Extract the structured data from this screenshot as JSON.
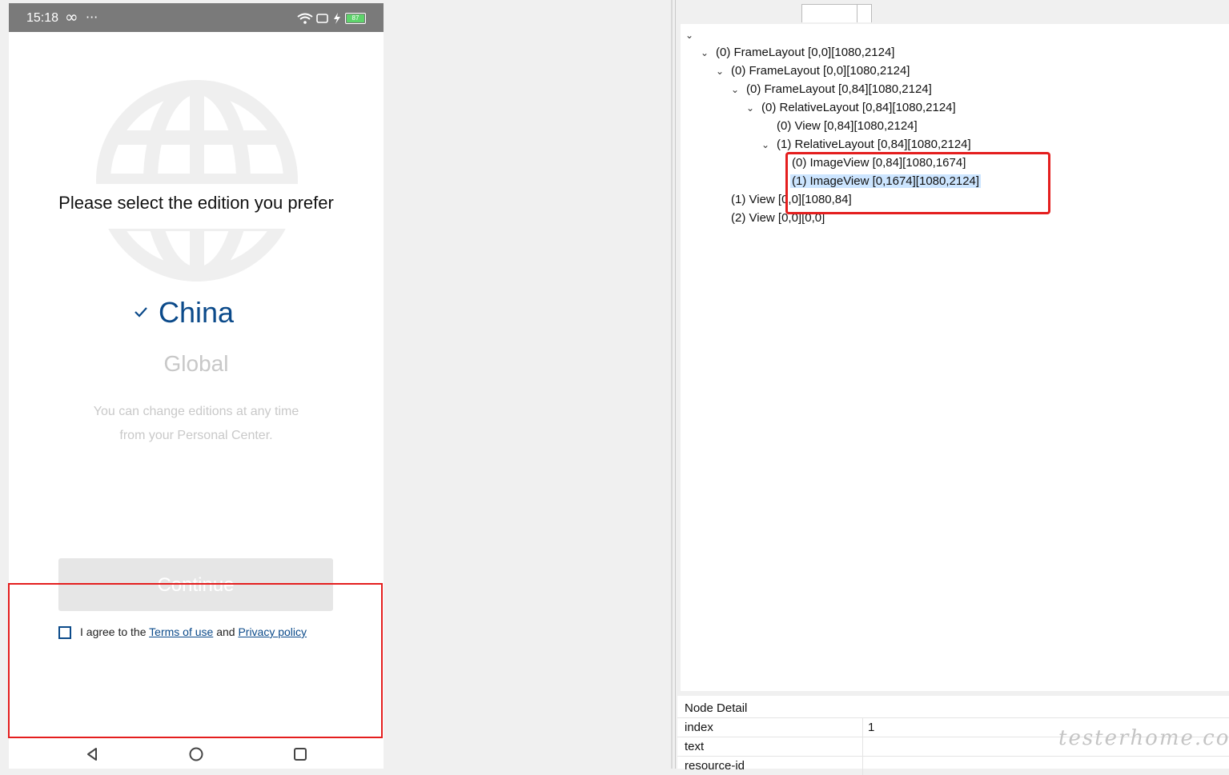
{
  "phone": {
    "status_time": "15:18",
    "status_infinity": "∞",
    "status_dots": "···",
    "battery_level": "87",
    "title": "Please select the edition you prefer",
    "editions": {
      "selected": "China",
      "other": "Global"
    },
    "hint_line1": "You can change editions at any time",
    "hint_line2": "from your Personal Center.",
    "continue_label": "Continue",
    "agree_prefix": "I agree to the",
    "terms_label": "Terms of use",
    "agree_and": "and",
    "privacy_label": "Privacy policy"
  },
  "tree": {
    "nodes": [
      {
        "label": "(0) FrameLayout [0,0][1080,2124]"
      },
      {
        "label": "(0) FrameLayout [0,0][1080,2124]"
      },
      {
        "label": "(0) FrameLayout [0,84][1080,2124]"
      },
      {
        "label": "(0) RelativeLayout [0,84][1080,2124]"
      },
      {
        "label": "(0) View [0,84][1080,2124]"
      },
      {
        "label": "(1) RelativeLayout [0,84][1080,2124]"
      },
      {
        "label": "(0) ImageView [0,84][1080,1674]"
      },
      {
        "label": "(1) ImageView [0,1674][1080,2124]"
      },
      {
        "label": "(1) View [0,0][1080,84]"
      },
      {
        "label": "(2) View [0,0][0,0]"
      }
    ]
  },
  "detail": {
    "title": "Node Detail",
    "rows": [
      {
        "key": "index",
        "value": "1"
      },
      {
        "key": "text",
        "value": ""
      },
      {
        "key": "resource-id",
        "value": ""
      }
    ]
  },
  "watermark": "testerhome.com",
  "colors": {
    "accent": "#0b4a8a",
    "highlight": "#e41e1e",
    "selection": "#cce5ff"
  }
}
